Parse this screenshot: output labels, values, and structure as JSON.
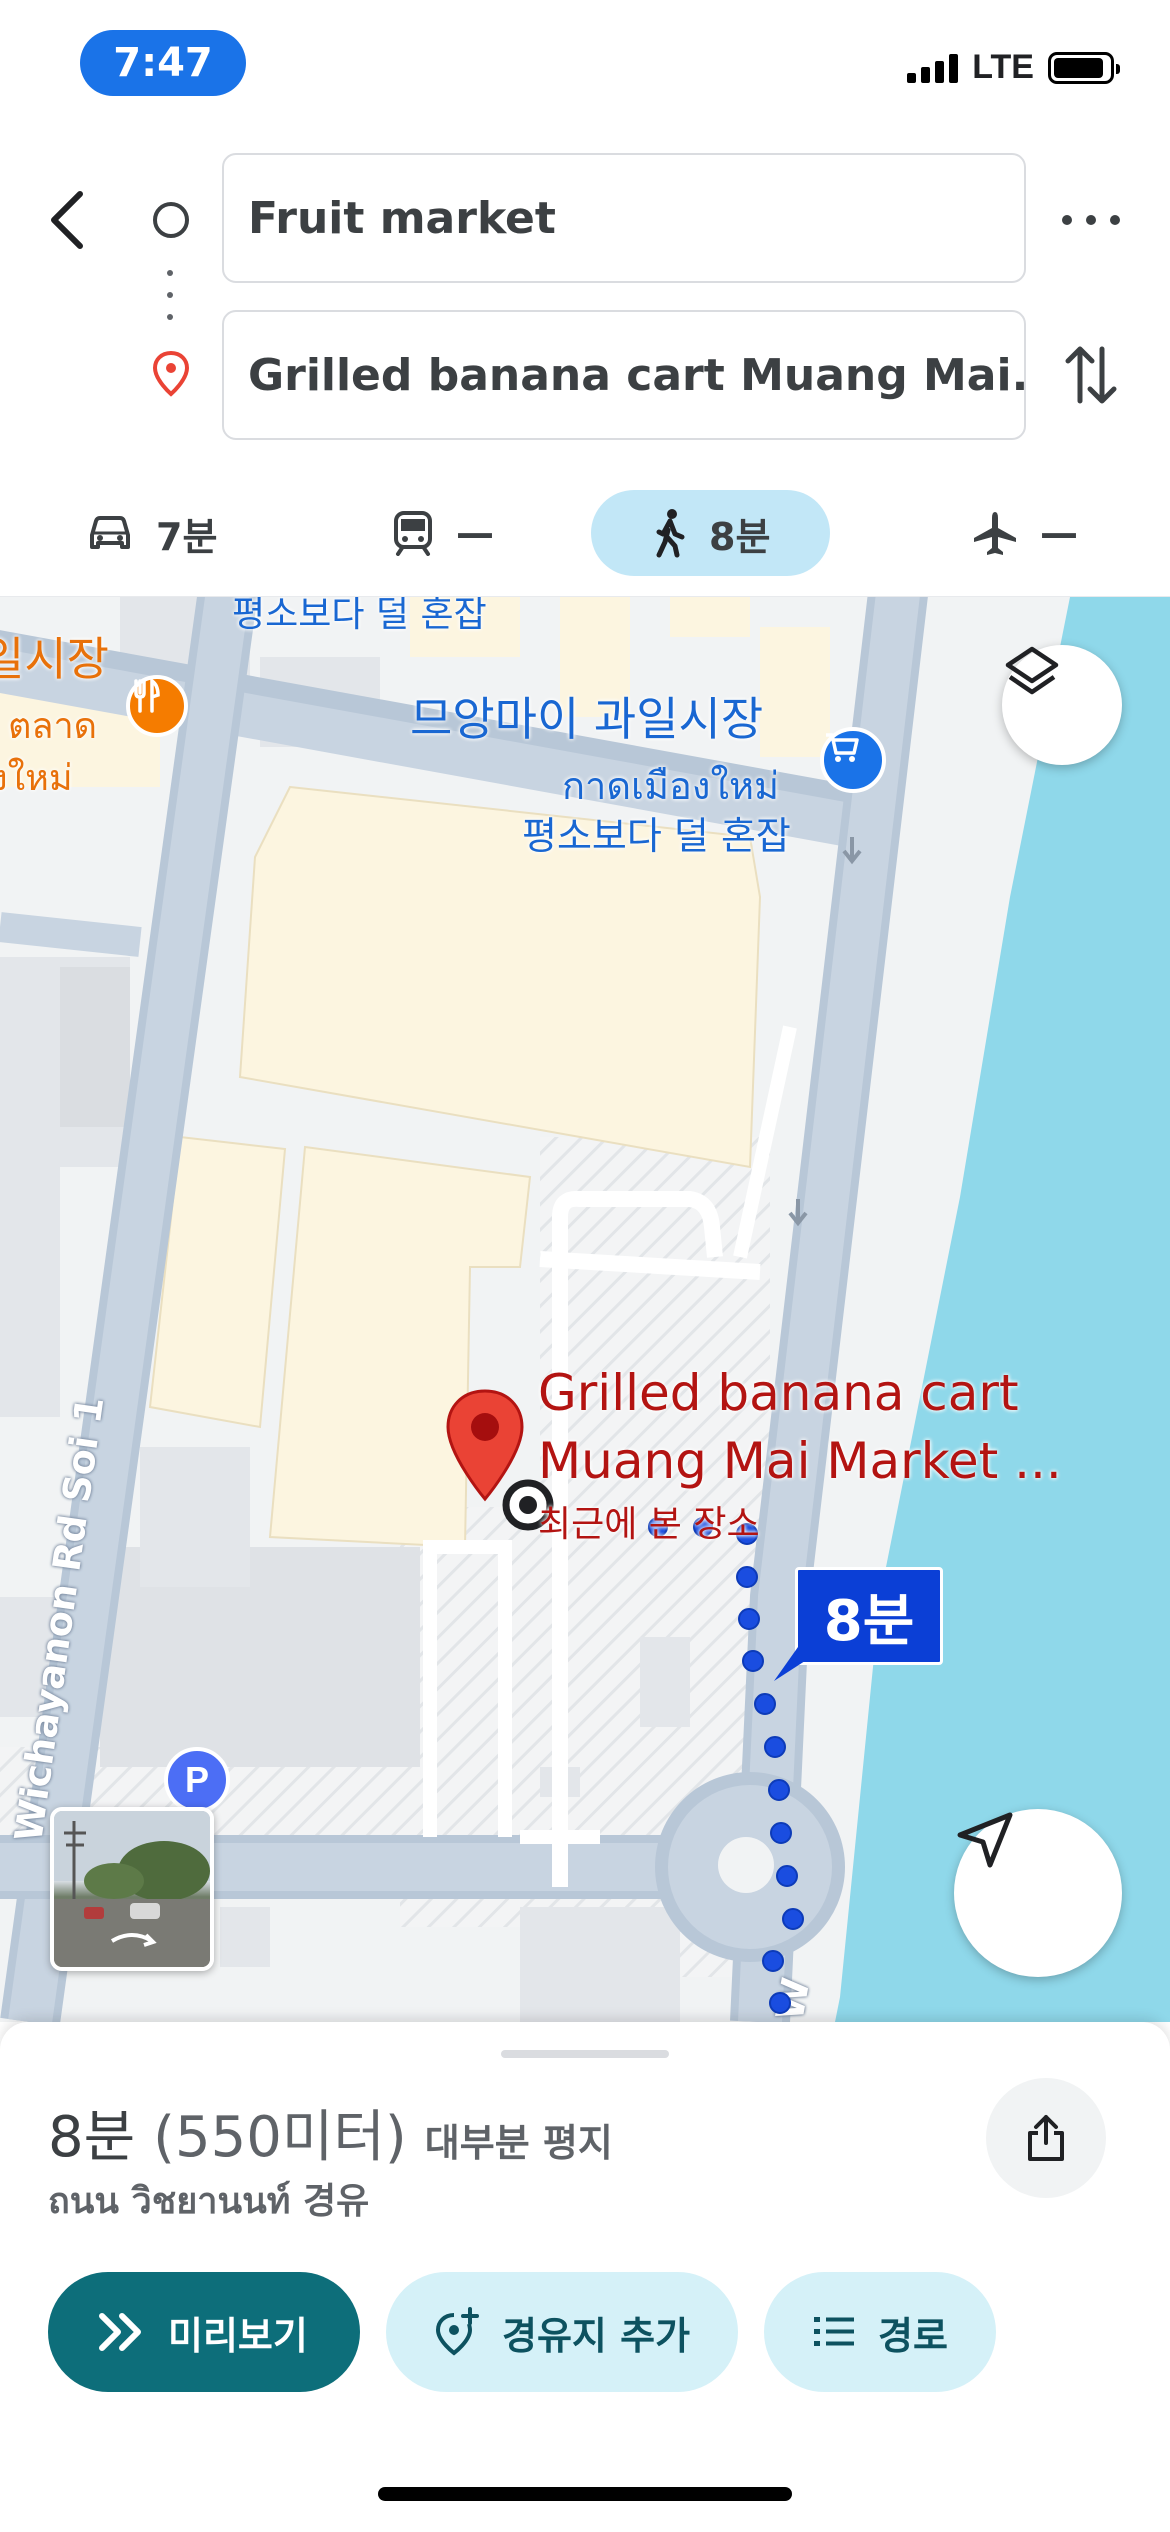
{
  "status_bar": {
    "time": "7:47",
    "network": "LTE",
    "battery_level": 0.9
  },
  "route": {
    "origin": "Fruit market",
    "destination": "Grilled banana cart Muang Mai..."
  },
  "modes": [
    {
      "name": "drive",
      "icon": "car-icon",
      "label": "7분"
    },
    {
      "name": "transit",
      "icon": "train-icon",
      "label": "—"
    },
    {
      "name": "walk",
      "icon": "walk-icon",
      "label": "8분",
      "selected": true
    },
    {
      "name": "flight",
      "icon": "plane-icon",
      "label": "—"
    }
  ],
  "map": {
    "labels": {
      "top_cut": "평소보다 덜 혼잡",
      "market_partial": "일시장",
      "thai_partial_1": "ตลาด",
      "thai_partial_2": "งใหม่",
      "market_ko": "므앙마이 과일시장",
      "market_th": "กาดเมืองใหม่",
      "busy": "평소보다 덜 혼잡",
      "road": "Wichayanon Rd Soi 1",
      "dest_line1": "Grilled banana cart",
      "dest_line2": "Muang Mai Market ...",
      "recent": "최근에 본 장소",
      "road_bottom": "W",
      "parking": "P"
    },
    "walk_time": "8분",
    "colors": {
      "water": "#8fd8ea",
      "road": "#b8c7d7",
      "building": "#fcf5e0",
      "route": "#1a4de0",
      "pin": "#ea4335"
    }
  },
  "sheet": {
    "time": "8분",
    "distance": "(550미터)",
    "note": "대부분 평지",
    "via": "ถนน วิชยานนท์ 경유",
    "actions": {
      "preview": "미리보기",
      "add_stop": "경유지 추가",
      "steps": "경로"
    }
  }
}
